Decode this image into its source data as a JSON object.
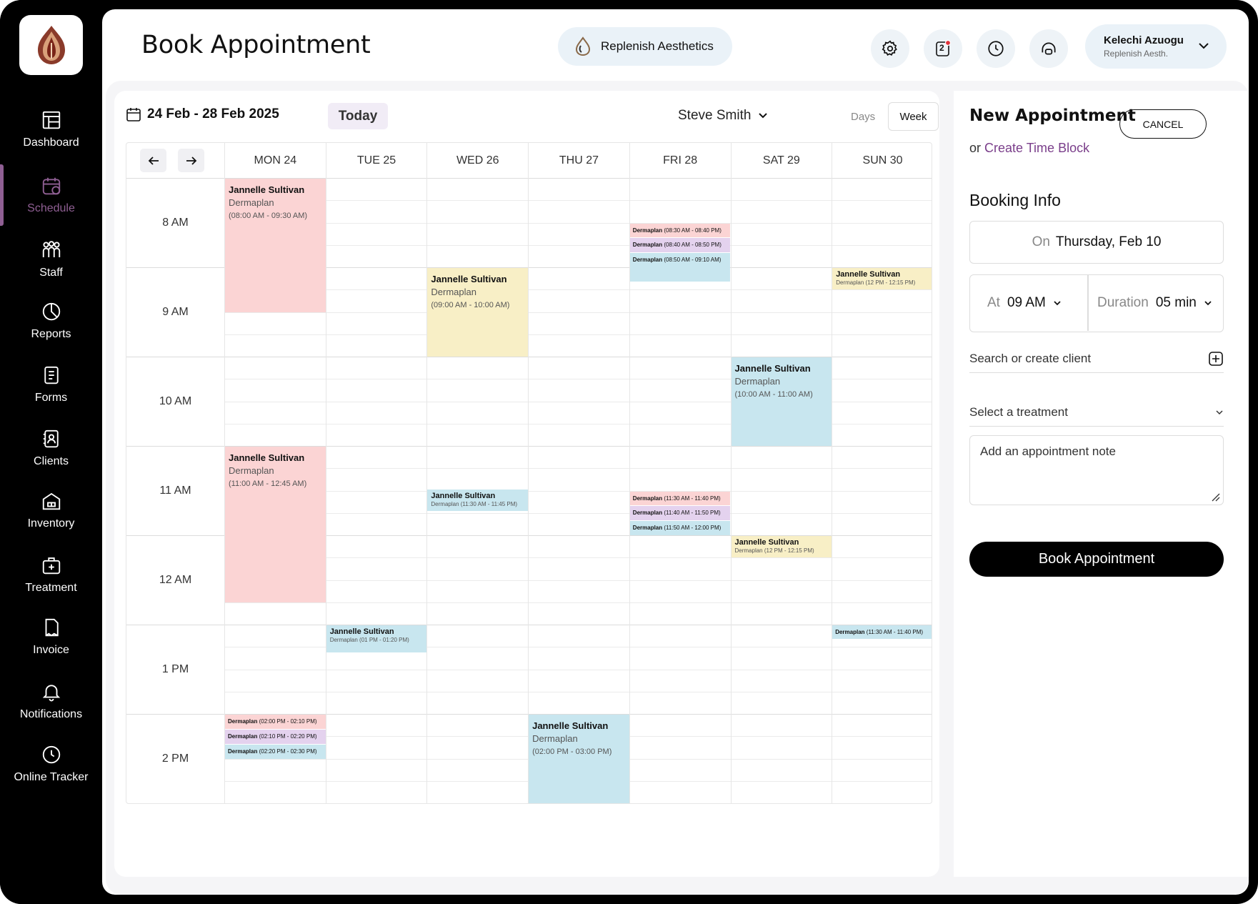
{
  "nav": [
    {
      "label": "Dashboard",
      "icon": "dashboard-icon"
    },
    {
      "label": "Schedule",
      "icon": "calendar-icon",
      "active": true
    },
    {
      "label": "Staff",
      "icon": "staff-icon"
    },
    {
      "label": "Reports",
      "icon": "reports-icon"
    },
    {
      "label": "Forms",
      "icon": "forms-icon"
    },
    {
      "label": "Clients",
      "icon": "clients-icon"
    },
    {
      "label": "Inventory",
      "icon": "inventory-icon"
    },
    {
      "label": "Treatment",
      "icon": "treatment-icon"
    },
    {
      "label": "Invoice",
      "icon": "invoice-icon"
    },
    {
      "label": "Notifications",
      "icon": "bell-icon"
    },
    {
      "label": "Online Tracker",
      "icon": "clock-icon"
    }
  ],
  "header": {
    "title": "Book Appointment",
    "org": "Replenish Aesthetics",
    "notification_count": "2",
    "user_name": "Kelechi Azuogu",
    "user_org": "Replenish Aesth."
  },
  "calendar": {
    "date_range": "24 Feb - 28 Feb 2025",
    "today_label": "Today",
    "staff": "Steve Smith",
    "view_days": "Days",
    "view_week": "Week",
    "days": [
      "MON 24",
      "TUE 25",
      "WED 26",
      "THU 27",
      "FRI 28",
      "SAT 29",
      "SUN 30"
    ],
    "hours": [
      "8 AM",
      "9 AM",
      "10 AM",
      "11 AM",
      "12 AM",
      "1 PM",
      "2 PM"
    ],
    "events": [
      {
        "day": 0,
        "start": 0,
        "end": 1.5,
        "name": "Jannelle Sultivan",
        "treatment": "Dermaplan",
        "time": "(08:00 AM - 09:30 AM)",
        "color": "pink",
        "style": "big"
      },
      {
        "day": 4,
        "start": 0.5,
        "end": 0.666,
        "text": "(08:30 AM - 08:40 PM)",
        "color": "pink",
        "style": "sm"
      },
      {
        "day": 4,
        "start": 0.666,
        "end": 0.833,
        "text": "(08:40 AM - 08:50 PM)",
        "color": "lav",
        "style": "sm"
      },
      {
        "day": 4,
        "start": 0.833,
        "end": 1.16,
        "text": "(08:50 AM - 09:10 AM)",
        "color": "blue",
        "style": "sm"
      },
      {
        "day": 2,
        "start": 1,
        "end": 2,
        "name": "Jannelle Sultivan",
        "treatment": "Dermaplan",
        "time": "(09:00 AM - 10:00 AM)",
        "color": "yel",
        "style": "big"
      },
      {
        "day": 6,
        "start": 1,
        "end": 1.25,
        "name": "Jannelle Sultivan",
        "sub": "Dermaplan (12 PM - 12:15 PM)",
        "color": "yel",
        "style": "mid"
      },
      {
        "day": 5,
        "start": 2,
        "end": 3,
        "name": "Jannelle Sultivan",
        "treatment": "Dermaplan",
        "time": "(10:00 AM - 11:00 AM)",
        "color": "blue",
        "style": "big"
      },
      {
        "day": 0,
        "start": 3,
        "end": 4.75,
        "name": "Jannelle Sultivan",
        "treatment": "Dermaplan",
        "time": "(11:00 AM - 12:45 AM)",
        "color": "pink",
        "style": "big"
      },
      {
        "day": 2,
        "start": 3.48,
        "end": 3.73,
        "name": "Jannelle Sultivan",
        "sub": "Dermaplan (11:30 AM - 11:45 PM)",
        "color": "blue",
        "style": "mid"
      },
      {
        "day": 4,
        "start": 3.5,
        "end": 3.666,
        "text": "(11:30 AM - 11:40 PM)",
        "color": "pink",
        "style": "sm"
      },
      {
        "day": 4,
        "start": 3.666,
        "end": 3.833,
        "text": "(11:40 AM - 11:50 PM)",
        "color": "lav",
        "style": "sm"
      },
      {
        "day": 4,
        "start": 3.833,
        "end": 4.0,
        "text": "(11:50 AM - 12:00 PM)",
        "color": "blue",
        "style": "sm"
      },
      {
        "day": 5,
        "start": 4,
        "end": 4.25,
        "name": "Jannelle Sultivan",
        "sub": "Dermaplan (12 PM - 12:15 PM)",
        "color": "yel",
        "style": "mid"
      },
      {
        "day": 1,
        "start": 5,
        "end": 5.31,
        "name": "Jannelle Sultivan",
        "sub": "Dermaplan (01 PM - 01:20 PM)",
        "color": "blue",
        "style": "mid"
      },
      {
        "day": 6,
        "start": 5,
        "end": 5.16,
        "text": "(11:30 AM - 11:40 PM)",
        "color": "blue",
        "style": "sm"
      },
      {
        "day": 0,
        "start": 6,
        "end": 6.166,
        "text": "(02:00 PM - 02:10 PM)",
        "color": "pink",
        "style": "sm"
      },
      {
        "day": 0,
        "start": 6.166,
        "end": 6.333,
        "text": "(02:10 PM - 02:20 PM)",
        "color": "lav",
        "style": "sm"
      },
      {
        "day": 0,
        "start": 6.333,
        "end": 6.5,
        "text": "(02:20 PM - 02:30 PM)",
        "color": "blue",
        "style": "sm"
      },
      {
        "day": 3,
        "start": 6,
        "end": 7,
        "name": "Jannelle Sultivan",
        "treatment": "Dermaplan",
        "time": "(02:00 PM - 03:00 PM)",
        "color": "blue",
        "style": "big"
      }
    ],
    "short_label": "Dermaplan"
  },
  "panel": {
    "title": "New Appointment",
    "cancel": "CANCEL",
    "or_text": "or",
    "create_time_block": "Create Time Block",
    "booking_info": "Booking Info",
    "on_label": "On",
    "on_value": "Thursday, Feb 10",
    "at_label": "At",
    "at_value": "09 AM",
    "duration_label": "Duration",
    "duration_value": "05 min",
    "client_placeholder": "Search or create client",
    "treatment_placeholder": "Select a treatment",
    "note_placeholder": "Add an appointment note",
    "book_button": "Book Appointment"
  },
  "colors": {
    "accent": "#8f5f93",
    "pink": "#fbd4d4",
    "lavender": "#e4d2ee",
    "blue": "#c8e6ef",
    "yellow": "#f8efc6"
  }
}
